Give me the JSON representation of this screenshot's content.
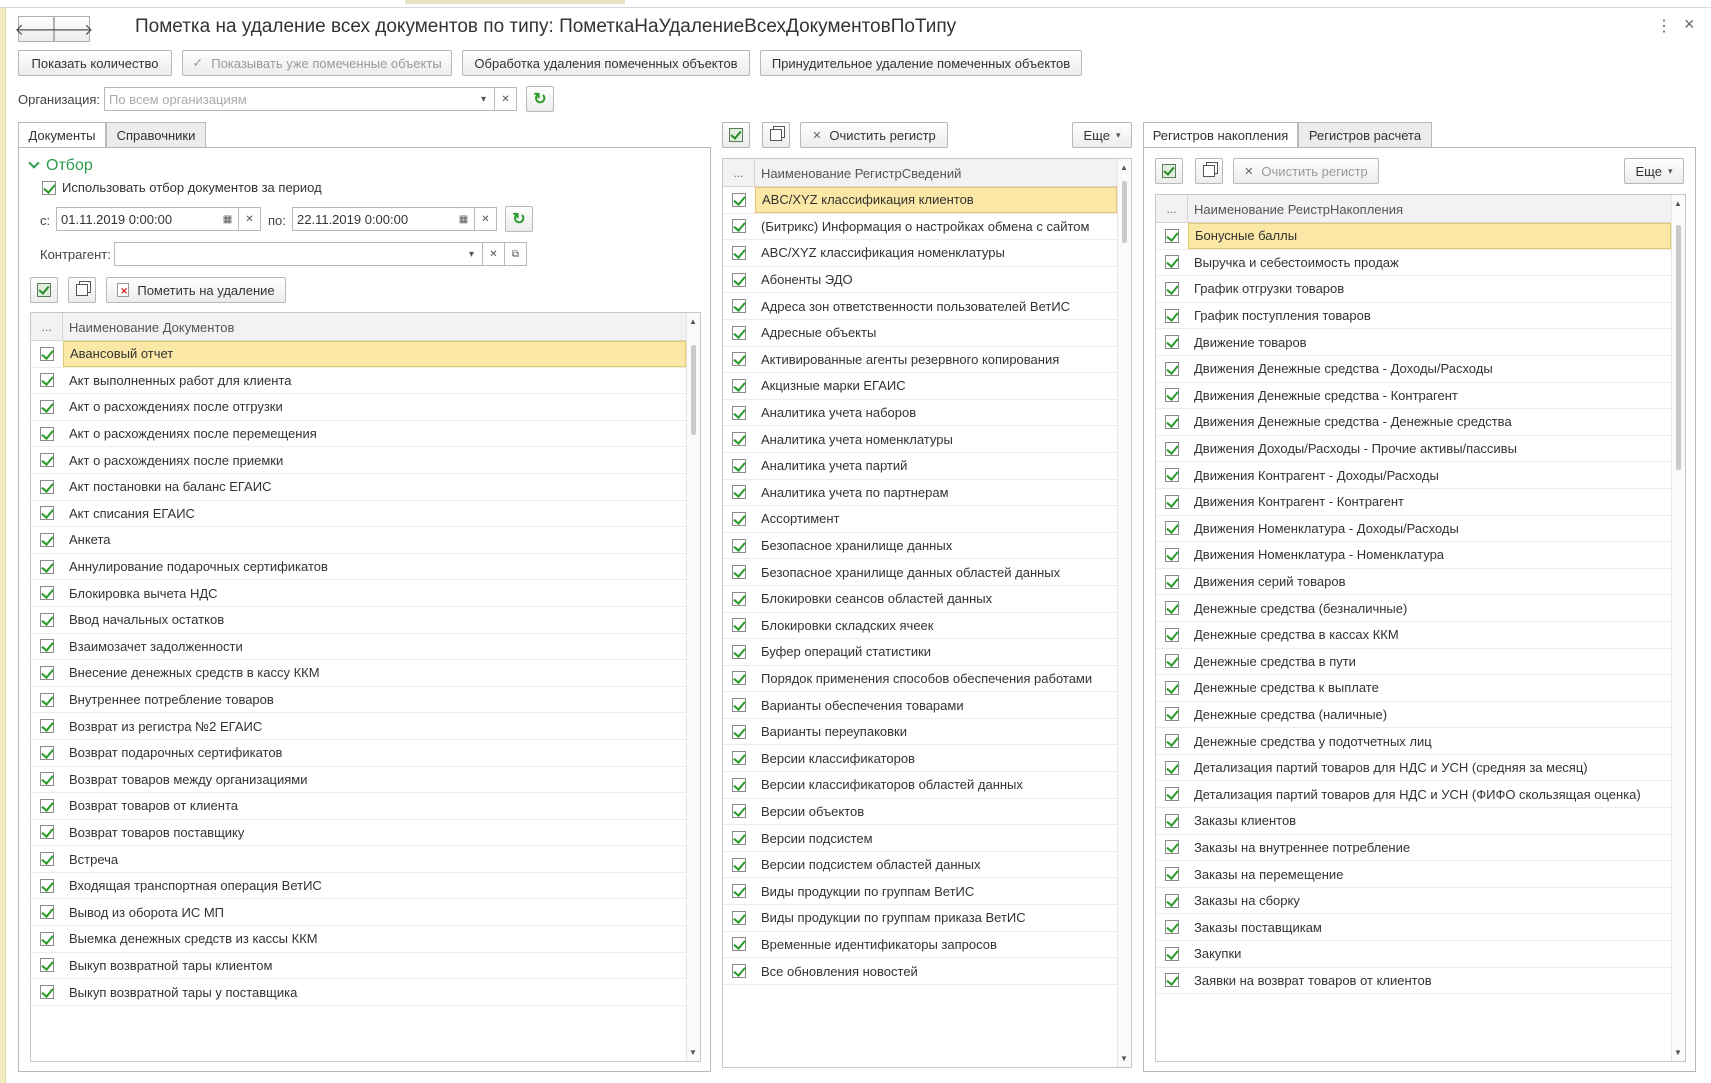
{
  "window": {
    "title": "Пометка на удаление всех документов по типу: ПометкаНаУдалениеВсехДокументовПоТипу",
    "back_glyph": "🡐",
    "forward_glyph": "🡒",
    "more_glyph": "⋮",
    "close_glyph": "×"
  },
  "toolbar": {
    "show_count": "Показать количество",
    "show_marked": "Показывать уже помеченные объекты",
    "process_deletion": "Обработка удаления помеченных объектов",
    "force_deletion": "Принудительное удаление помеченных объектов"
  },
  "organization": {
    "label": "Организация:",
    "placeholder": "По всем организациям"
  },
  "left_tabs": [
    "Документы",
    "Справочники"
  ],
  "filter": {
    "section_title": "Отбор",
    "use_period_label": "Использовать отбор документов за период",
    "from_label": "с:",
    "from_value": "01.11.2019  0:00:00",
    "to_label": "по:",
    "to_value": "22.11.2019  0:00:00",
    "counterparty_label": "Контрагент:",
    "counterparty_value": ""
  },
  "documents": {
    "mark_button": "Пометить на удаление",
    "header": "Наименование Документов",
    "dots": "...",
    "rows": [
      "Авансовый отчет",
      "Акт выполненных работ для клиента",
      "Акт о расхождениях после отгрузки",
      "Акт о расхождениях после перемещения",
      "Акт о расхождениях после приемки",
      "Акт постановки на баланс ЕГАИС",
      "Акт списания ЕГАИС",
      "Анкета",
      "Аннулирование подарочных сертификатов",
      "Блокировка вычета НДС",
      "Ввод начальных остатков",
      "Взаимозачет задолженности",
      "Внесение денежных средств в кассу ККМ",
      "Внутреннее потребление товаров",
      "Возврат из регистра №2 ЕГАИС",
      "Возврат подарочных сертификатов",
      "Возврат товаров между организациями",
      "Возврат товаров от клиента",
      "Возврат товаров поставщику",
      "Встреча",
      "Входящая транспортная операция ВетИС",
      "Вывод из оборота ИС МП",
      "Выемка денежных средств из кассы ККМ",
      "Выкуп возвратной тары клиентом",
      "Выкуп возвратной тары у поставщика"
    ]
  },
  "info_registers": {
    "clear_button": "Очистить регистр",
    "more_button": "Еще",
    "header": "Наименование РегистрСведений",
    "dots": "...",
    "rows": [
      "ABC/XYZ классификация клиентов",
      "(Битрикс) Информация о настройках обмена с сайтом",
      "ABC/XYZ классификация номенклатуры",
      "Абоненты ЭДО",
      "Адреса зон ответственности пользователей ВетИС",
      "Адресные объекты",
      "Активированные агенты резервного копирования",
      "Акцизные марки ЕГАИС",
      "Аналитика учета наборов",
      "Аналитика учета номенклатуры",
      "Аналитика учета партий",
      "Аналитика учета по партнерам",
      "Ассортимент",
      "Безопасное хранилище данных",
      "Безопасное хранилище данных областей данных",
      "Блокировки сеансов областей данных",
      "Блокировки складских ячеек",
      "Буфер операций статистики",
      "Порядок применения способов обеспечения работами",
      "Варианты обеспечения товарами",
      "Варианты переупаковки",
      "Версии классификаторов",
      "Версии классификаторов областей данных",
      "Версии объектов",
      "Версии подсистем",
      "Версии подсистем областей данных",
      "Виды продукции по группам ВетИС",
      "Виды продукции по группам приказа ВетИС",
      "Временные идентификаторы запросов",
      "Все обновления новостей"
    ]
  },
  "right_tabs": [
    "Регистров накопления",
    "Регистров расчета"
  ],
  "accum_registers": {
    "clear_button": "Очистить регистр",
    "more_button": "Еще",
    "header": "Наименование РеистрНакопления",
    "dots": "...",
    "rows": [
      "Бонусные баллы",
      "Выручка и себестоимость продаж",
      "График отгрузки товаров",
      "График поступления товаров",
      "Движение товаров",
      "Движения Денежные средства - Доходы/Расходы",
      "Движения Денежные средства - Контрагент",
      "Движения Денежные средства - Денежные средства",
      "Движения Доходы/Расходы - Прочие активы/пассивы",
      "Движения Контрагент - Доходы/Расходы",
      "Движения Контрагент - Контрагент",
      "Движения Номенклатура - Доходы/Расходы",
      "Движения Номенклатура - Номенклатура",
      "Движения серий товаров",
      "Денежные средства (безналичные)",
      "Денежные средства в кассах ККМ",
      "Денежные средства в пути",
      "Денежные средства к выплате",
      "Денежные средства (наличные)",
      "Денежные средства у подотчетных лиц",
      "Детализация партий товаров для НДС и УСН (средняя за месяц)",
      "Детализация партий товаров для НДС и УСН (ФИФО скользящая оценка)",
      "Заказы клиентов",
      "Заказы на внутреннее потребление",
      "Заказы на перемещение",
      "Заказы на сборку",
      "Заказы поставщикам",
      "Закупки",
      "Заявки на возврат товаров от клиентов"
    ]
  }
}
